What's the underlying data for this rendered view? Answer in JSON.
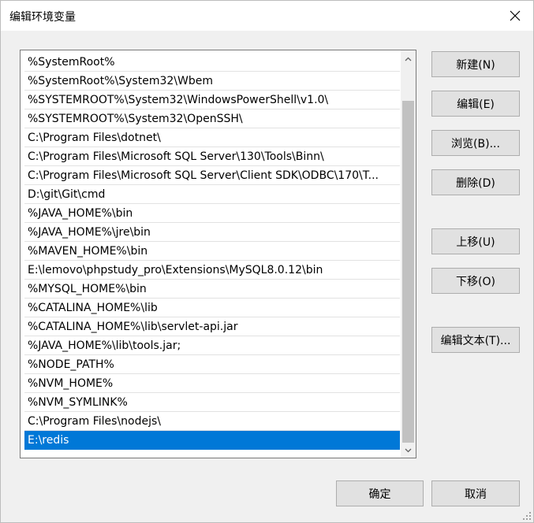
{
  "window": {
    "title": "编辑环境变量"
  },
  "paths": [
    "%SystemRoot%",
    "%SystemRoot%\\System32\\Wbem",
    "%SYSTEMROOT%\\System32\\WindowsPowerShell\\v1.0\\",
    "%SYSTEMROOT%\\System32\\OpenSSH\\",
    "C:\\Program Files\\dotnet\\",
    "C:\\Program Files\\Microsoft SQL Server\\130\\Tools\\Binn\\",
    "C:\\Program Files\\Microsoft SQL Server\\Client SDK\\ODBC\\170\\T...",
    "D:\\git\\Git\\cmd",
    "%JAVA_HOME%\\bin",
    "%JAVA_HOME%\\jre\\bin",
    "%MAVEN_HOME%\\bin",
    "E:\\lemovo\\phpstudy_pro\\Extensions\\MySQL8.0.12\\bin",
    "%MYSQL_HOME%\\bin",
    "%CATALINA_HOME%\\lib",
    "%CATALINA_HOME%\\lib\\servlet-api.jar",
    "%JAVA_HOME%\\lib\\tools.jar;",
    "%NODE_PATH%",
    "%NVM_HOME%",
    "%NVM_SYMLINK%",
    "C:\\Program Files\\nodejs\\",
    "E:\\redis"
  ],
  "selected_index": 20,
  "buttons": {
    "new": "新建(N)",
    "edit": "编辑(E)",
    "browse": "浏览(B)...",
    "delete": "删除(D)",
    "move_up": "上移(U)",
    "move_down": "下移(O)",
    "edit_text": "编辑文本(T)...",
    "ok": "确定",
    "cancel": "取消"
  },
  "colors": {
    "selection": "#0078d7",
    "dialog_bg": "#f0f0f0",
    "button_bg": "#e1e1e1"
  },
  "icons": {
    "close": "close-icon",
    "scroll_up": "chevron-up-icon",
    "scroll_down": "chevron-down-icon"
  }
}
